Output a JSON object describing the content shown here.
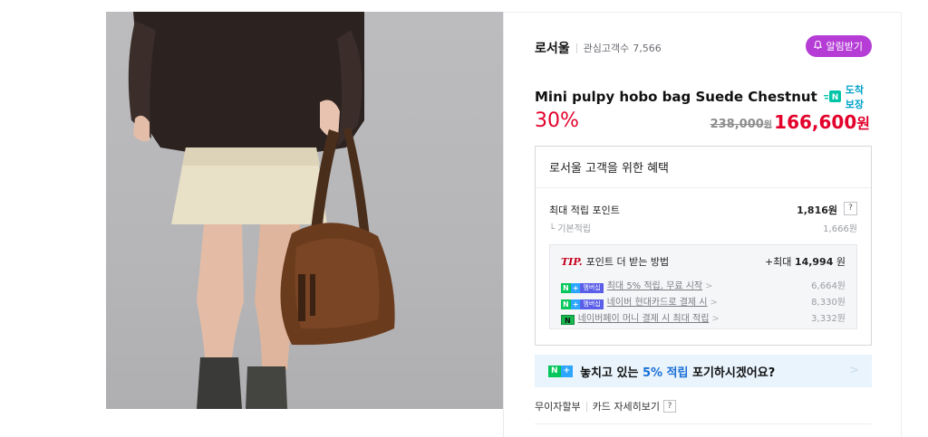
{
  "store": {
    "name": "로서울",
    "follower_label": "관심고객수",
    "follower_count": "7,566",
    "alarm_label": "알림받기"
  },
  "product": {
    "title": "Mini pulpy hobo bag Suede Chestnut",
    "guarantee_label": "도착보장",
    "discount": "30%",
    "original_price": "238,000",
    "original_unit": "원",
    "sale_price": "166,600",
    "sale_unit": "원"
  },
  "benefits": {
    "heading": "로서울 고객을 위한 혜택",
    "max_points_label": "최대 적립 포인트",
    "max_points_value": "1,816원",
    "help_glyph": "?",
    "basic_label": "└ 기본적립",
    "basic_value": "1,666원",
    "tip": {
      "badge": "TIP.",
      "title": "포인트 더 받는 방법",
      "max_prefix": "+최대",
      "max_value": "14,994",
      "max_unit": "원",
      "items": [
        {
          "badge_n": "N",
          "badge_plus": "+",
          "badge_tag": "멤버십",
          "label": "최대 5% 적립, 무료 시작",
          "arrow": ">",
          "amount": "6,664원"
        },
        {
          "badge_n": "N",
          "badge_plus": "+",
          "badge_tag": "멤버십",
          "label": "네이버 현대카드로 결제 시",
          "arrow": ">",
          "amount": "8,330원"
        },
        {
          "badge_pay": "N",
          "label": "네이버페이 머니 결제 시 최대 적립",
          "arrow": ">",
          "amount": "3,332원"
        }
      ]
    }
  },
  "promo": {
    "badge_n": "N",
    "badge_plus": "+",
    "text_before": "놓치고 있는 ",
    "highlight": "5% 적립",
    "text_after": " 포기하시겠어요?",
    "arrow": ">"
  },
  "links": {
    "installment": "무이자할부",
    "card_details": "카드 자세히보기",
    "help_glyph": "?"
  },
  "colors": {
    "alarm_purple": "#b53dd6",
    "price_red": "#e3002b",
    "guarantee_teal": "#00a2c9",
    "naver_green": "#03c75a",
    "promo_bg": "#e9f4fc"
  }
}
